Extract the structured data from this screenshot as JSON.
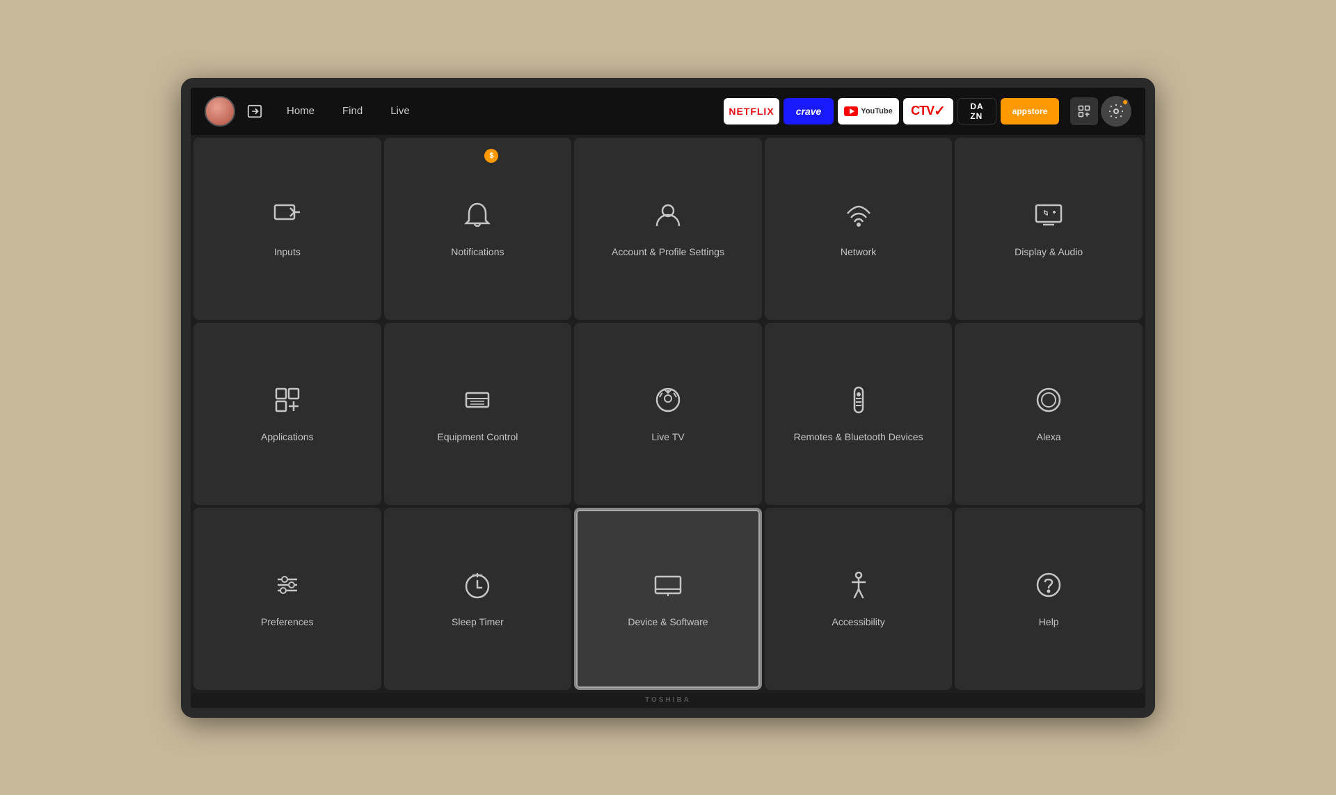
{
  "nav": {
    "links": [
      "Home",
      "Find",
      "Live"
    ],
    "apps": [
      {
        "id": "netflix",
        "label": "NETFLIX"
      },
      {
        "id": "crave",
        "label": "crave"
      },
      {
        "id": "youtube",
        "label": "YouTube"
      },
      {
        "id": "ctv",
        "label": "CTV"
      },
      {
        "id": "dazn",
        "label": "DAZN"
      },
      {
        "id": "appstore",
        "label": "appstore"
      }
    ]
  },
  "settings": {
    "tiles": [
      {
        "id": "inputs",
        "label": "Inputs",
        "icon": "inputs"
      },
      {
        "id": "notifications",
        "label": "Notifications",
        "icon": "bell",
        "badge": "$"
      },
      {
        "id": "account",
        "label": "Account & Profile Settings",
        "icon": "account"
      },
      {
        "id": "network",
        "label": "Network",
        "icon": "wifi"
      },
      {
        "id": "display-audio",
        "label": "Display & Audio",
        "icon": "display"
      },
      {
        "id": "applications",
        "label": "Applications",
        "icon": "apps"
      },
      {
        "id": "equipment-control",
        "label": "Equipment Control",
        "icon": "equipment"
      },
      {
        "id": "live-tv",
        "label": "Live TV",
        "icon": "livetv"
      },
      {
        "id": "remotes",
        "label": "Remotes & Bluetooth Devices",
        "icon": "remote"
      },
      {
        "id": "alexa",
        "label": "Alexa",
        "icon": "alexa"
      },
      {
        "id": "preferences",
        "label": "Preferences",
        "icon": "preferences"
      },
      {
        "id": "sleep-timer",
        "label": "Sleep Timer",
        "icon": "timer"
      },
      {
        "id": "device-software",
        "label": "Device & Software",
        "icon": "device",
        "active": true
      },
      {
        "id": "accessibility",
        "label": "Accessibility",
        "icon": "accessibility"
      },
      {
        "id": "help",
        "label": "Help",
        "icon": "help"
      }
    ]
  },
  "brand": "TOSHIBA"
}
